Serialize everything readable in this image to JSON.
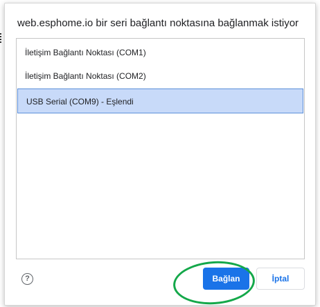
{
  "dialog": {
    "title": "web.esphome.io bir seri bağlantı noktasına bağlanmak istiyor"
  },
  "ports": [
    {
      "label": "İletişim Bağlantı Noktası (COM1)",
      "selected": false
    },
    {
      "label": "İletişim Bağlantı Noktası (COM2)",
      "selected": false
    },
    {
      "label": "USB Serial (COM9) - Eşlendi",
      "selected": true
    }
  ],
  "help": {
    "icon": "help-circle-icon",
    "glyph": "?"
  },
  "buttons": {
    "connect_label": "Bağlan",
    "cancel_label": "İptal"
  },
  "colors": {
    "primary": "#1a73e8",
    "selected_bg": "#c8daf9",
    "selected_border": "#5b8fd9",
    "highlight_annotation": "#14a84a"
  }
}
